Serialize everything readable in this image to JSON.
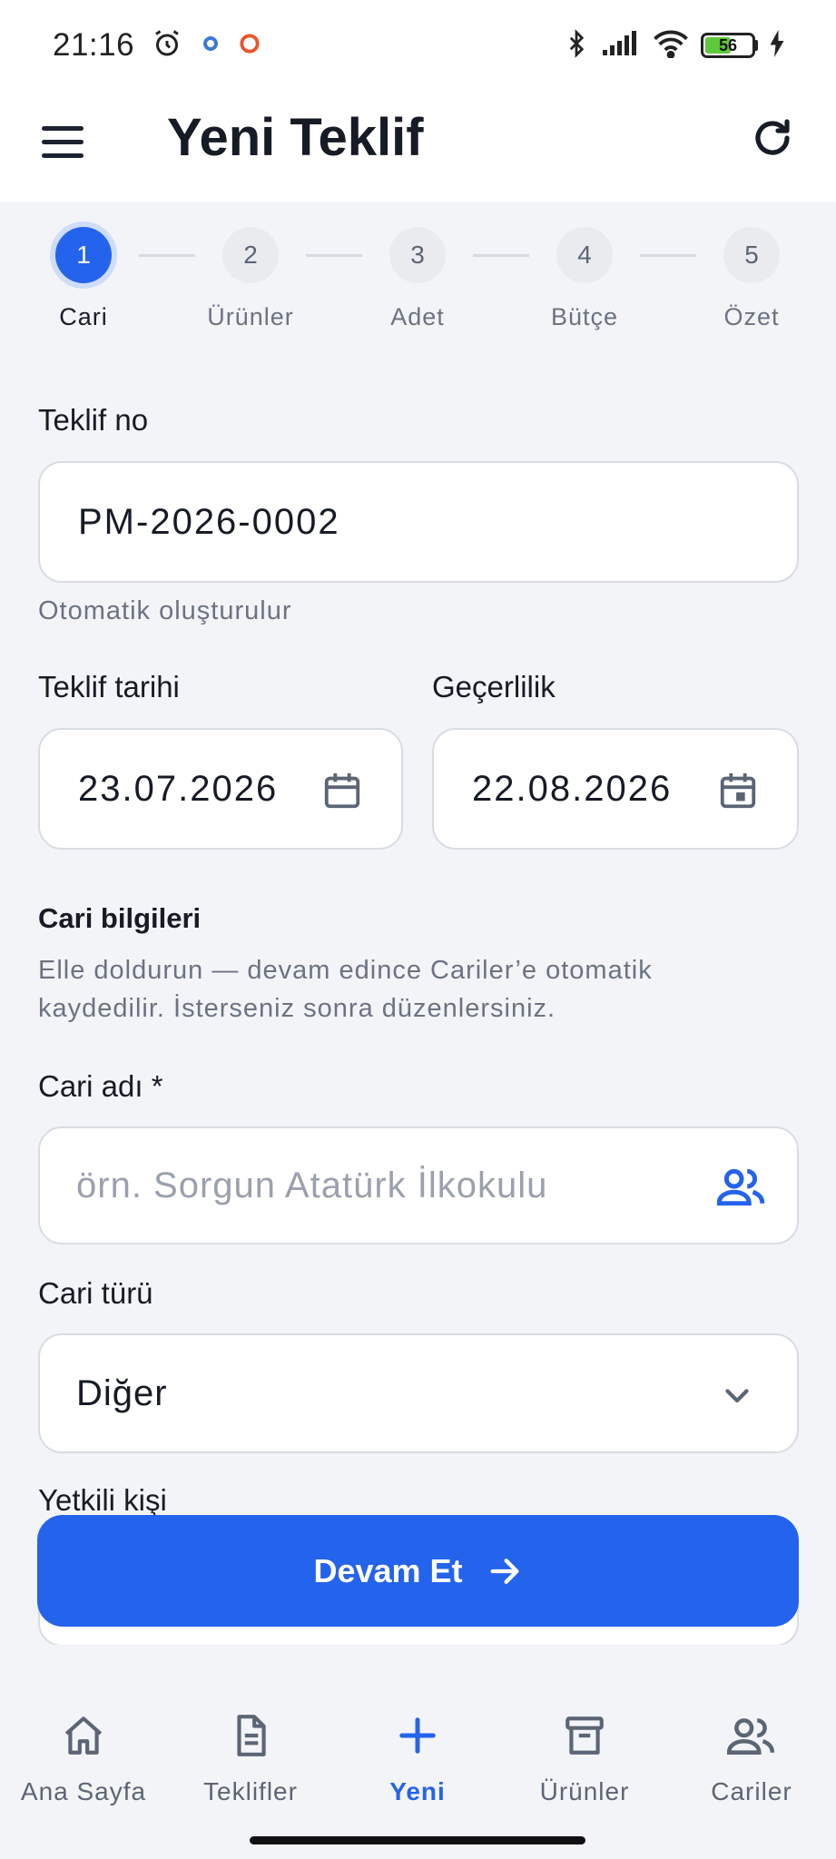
{
  "status_bar": {
    "time": "21:16",
    "battery": "56"
  },
  "header": {
    "title": "Yeni Teklif"
  },
  "stepper": {
    "steps": [
      {
        "number": "1",
        "label": "Cari"
      },
      {
        "number": "2",
        "label": "Ürünler"
      },
      {
        "number": "3",
        "label": "Adet"
      },
      {
        "number": "4",
        "label": "Bütçe"
      },
      {
        "number": "5",
        "label": "Özet"
      }
    ],
    "active_step": 1
  },
  "form": {
    "offer_no": {
      "label": "Teklif no",
      "value": "PM-2026-0002",
      "hint": "Otomatik oluşturulur"
    },
    "offer_date": {
      "label": "Teklif tarihi",
      "value": "23.07.2026"
    },
    "validity": {
      "label": "Geçerlilik",
      "value": "22.08.2026"
    },
    "customer_section": {
      "title": "Cari bilgileri",
      "description_line1": "Elle doldurun — devam edince Cariler’e otomatik",
      "description_line2": "kaydedilir. İsterseniz sonra düzenlersiniz."
    },
    "customer_name": {
      "label": "Cari adı *",
      "placeholder": "örn. Sorgun Atatürk İlkokulu"
    },
    "customer_type": {
      "label": "Cari türü",
      "value": "Diğer"
    },
    "contact_person": {
      "label": "Yetkili kişi"
    }
  },
  "continue_button": {
    "label": "Devam Et"
  },
  "bottom_nav": {
    "items": [
      {
        "label": "Ana Sayfa",
        "icon": "home-icon"
      },
      {
        "label": "Teklifler",
        "icon": "document-icon"
      },
      {
        "label": "Yeni",
        "icon": "plus-icon"
      },
      {
        "label": "Ürünler",
        "icon": "archive-icon"
      },
      {
        "label": "Cariler",
        "icon": "users-icon"
      }
    ],
    "active": "Yeni"
  },
  "colors": {
    "primary": "#2463eb",
    "background": "#f3f4f7"
  }
}
